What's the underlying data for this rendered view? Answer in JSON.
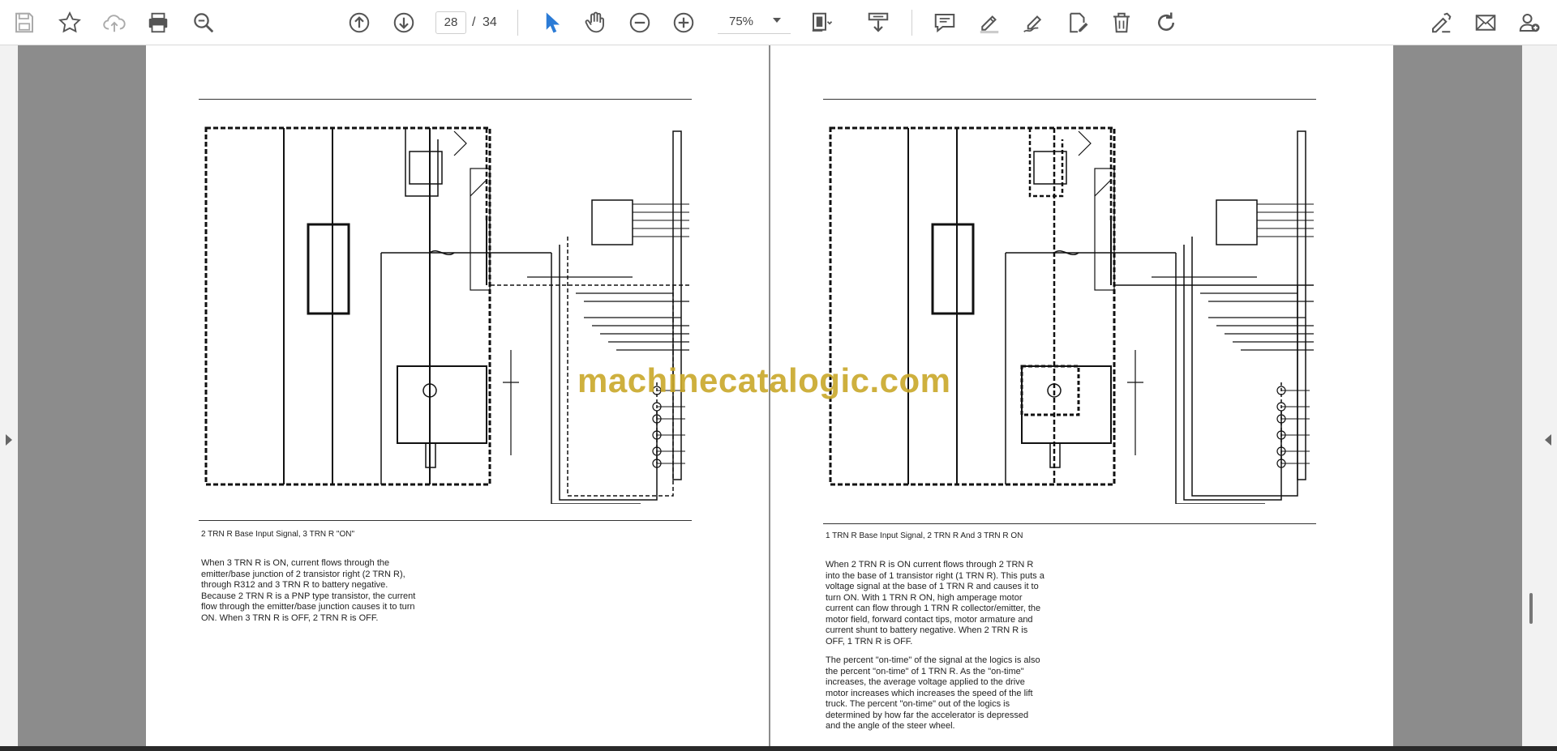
{
  "toolbar": {
    "current_page": "28",
    "page_separator": "/",
    "total_pages": "34",
    "zoom_level": "75%"
  },
  "pages": {
    "left": {
      "caption": "2 TRN R Base Input Signal, 3 TRN R \"ON\"",
      "paragraph": "When 3 TRN R is ON, current flows through the\nemitter/base junction of 2 transistor right (2 TRN R),\nthrough R312 and 3 TRN R to battery negative.\nBecause 2 TRN R is a PNP type transistor, the current\nflow through the emitter/base junction causes it to turn\nON. When 3 TRN R is OFF, 2 TRN R is OFF."
    },
    "right": {
      "caption": "1 TRN R Base Input Signal, 2 TRN R And 3 TRN R ON",
      "paragraph1": "When 2 TRN R is ON current flows through 2 TRN R\ninto the base of 1 transistor right (1 TRN R). This puts a\nvoltage signal at the base of 1 TRN R and causes it to\nturn ON. With 1 TRN R ON, high amperage motor\ncurrent can flow through 1 TRN R collector/emitter, the\nmotor field, forward contact tips, motor armature and\ncurrent shunt to battery negative. When 2 TRN R is\nOFF, 1 TRN R is OFF.",
      "paragraph2": "The percent \"on-time\" of the signal at the logics is also\nthe percent \"on-time\" of 1 TRN R. As the \"on-time\"\nincreases, the average voltage applied to the drive\nmotor increases which increases the speed of the lift\ntruck. The percent \"on-time\" out of the logics is\ndetermined by how far the accelerator is depressed\nand the angle of the steer wheel."
    }
  },
  "watermark": "machinecatalogic.com",
  "colors": {
    "accent_blue": "#2b7bd6",
    "icon_gray": "#555555",
    "watermark_gold": "#c9a82a",
    "viewer_bg": "#8c8c8c"
  },
  "icons": [
    "save-icon",
    "bookmark-star-icon",
    "cloud-upload-icon",
    "print-icon",
    "zoom-out-search-icon",
    "page-up-icon",
    "page-down-icon",
    "select-pointer-icon",
    "hand-pan-icon",
    "zoom-out-icon",
    "zoom-in-icon",
    "page-fit-icon",
    "scroll-mode-icon",
    "comment-icon",
    "highlight-pen-icon",
    "draw-icon",
    "edit-text-icon",
    "delete-icon",
    "rotate-icon",
    "fill-sign-icon",
    "email-icon",
    "add-user-icon"
  ]
}
